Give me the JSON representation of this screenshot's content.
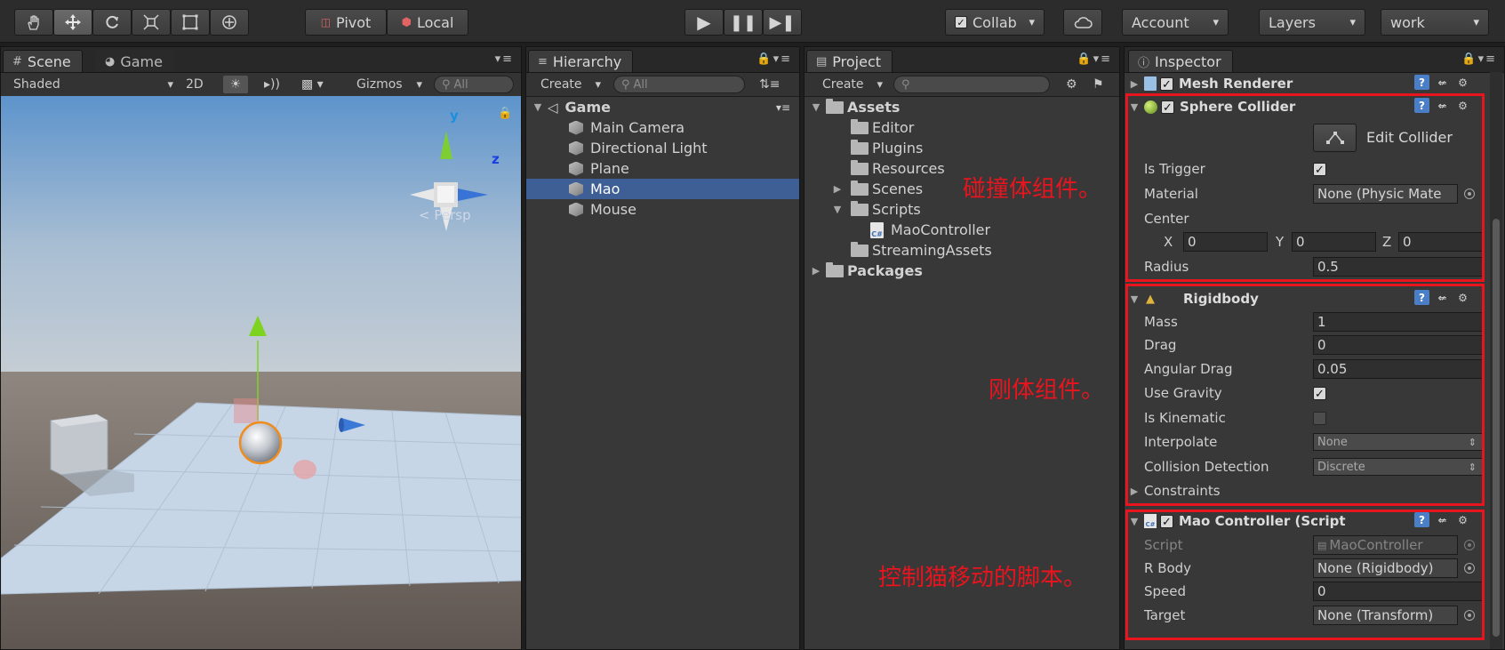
{
  "toolbar": {
    "pivot": "Pivot",
    "local": "Local",
    "collab": "Collab",
    "account": "Account",
    "layers": "Layers",
    "layout": "work"
  },
  "scene": {
    "tab_scene": "Scene",
    "tab_game": "Game",
    "shading": "Shaded",
    "mode_2d": "2D",
    "gizmos": "Gizmos",
    "search_placeholder": "All",
    "persp": "Persp",
    "axis_y": "y",
    "axis_z": "z"
  },
  "hierarchy": {
    "tab": "Hierarchy",
    "create": "Create",
    "search_placeholder": "All",
    "root": "Game",
    "items": [
      "Main Camera",
      "Directional Light",
      "Plane",
      "Mao",
      "Mouse"
    ],
    "selected": "Mao"
  },
  "project": {
    "tab": "Project",
    "create": "Create",
    "assets": "Assets",
    "folders": [
      "Editor",
      "Plugins",
      "Resources",
      "Scenes",
      "Scripts"
    ],
    "script_file": "MaoController",
    "streaming": "StreamingAssets",
    "packages": "Packages"
  },
  "inspector": {
    "tab": "Inspector",
    "mesh_renderer": "Mesh Renderer",
    "sphere_collider": {
      "title": "Sphere Collider",
      "edit_collider": "Edit Collider",
      "is_trigger_label": "Is Trigger",
      "material_label": "Material",
      "material_value": "None (Physic Mate",
      "center_label": "Center",
      "x_label": "X",
      "x_value": "0",
      "y_label": "Y",
      "y_value": "0",
      "z_label": "Z",
      "z_value": "0",
      "radius_label": "Radius",
      "radius_value": "0.5"
    },
    "rigidbody": {
      "title": "Rigidbody",
      "mass_label": "Mass",
      "mass_value": "1",
      "drag_label": "Drag",
      "drag_value": "0",
      "angular_drag_label": "Angular Drag",
      "angular_drag_value": "0.05",
      "use_gravity_label": "Use Gravity",
      "is_kinematic_label": "Is Kinematic",
      "interpolate_label": "Interpolate",
      "interpolate_value": "None",
      "collision_label": "Collision Detection",
      "collision_value": "Discrete",
      "constraints_label": "Constraints"
    },
    "mao_controller": {
      "title": "Mao Controller (Script",
      "script_label": "Script",
      "script_value": "MaoController",
      "rbody_label": "R Body",
      "rbody_value": "None (Rigidbody)",
      "speed_label": "Speed",
      "speed_value": "0",
      "target_label": "Target",
      "target_value": "None (Transform)"
    }
  },
  "annotations": {
    "collider": "碰撞体组件。",
    "rigidbody": "刚体组件。",
    "script": "控制猫移动的脚本。"
  },
  "colors": {
    "highlight_red": "#e8141e",
    "selection_blue": "#3e5f96",
    "panel_bg": "#383838"
  }
}
